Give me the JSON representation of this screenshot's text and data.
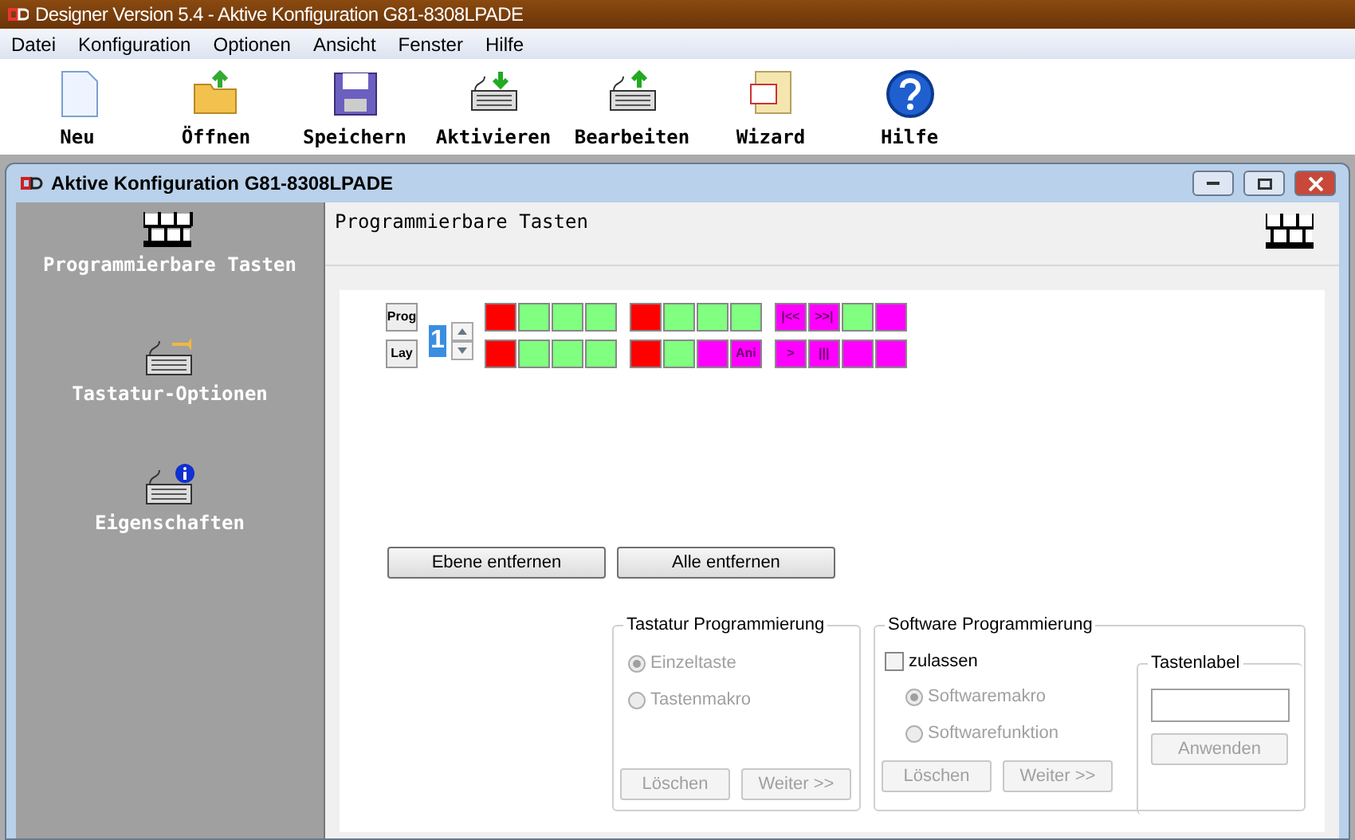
{
  "app_title": "Designer Version 5.4 - Aktive Konfiguration G81-8308LPADE",
  "menu": [
    "Datei",
    "Konfiguration",
    "Optionen",
    "Ansicht",
    "Fenster",
    "Hilfe"
  ],
  "toolbar": [
    {
      "label": "Neu",
      "kind": "new"
    },
    {
      "label": "Öffnen",
      "kind": "open"
    },
    {
      "label": "Speichern",
      "kind": "save"
    },
    {
      "label": "Aktivieren",
      "kind": "activate"
    },
    {
      "label": "Bearbeiten",
      "kind": "edit"
    },
    {
      "label": "Wizard",
      "kind": "wizard"
    },
    {
      "label": "Hilfe",
      "kind": "help"
    }
  ],
  "window": {
    "title": "Aktive Konfiguration G81-8308LPADE"
  },
  "sidebar": {
    "items": [
      {
        "label": "Programmierbare Tasten",
        "kind": "keys"
      },
      {
        "label": "Tastatur-Optionen",
        "kind": "options"
      },
      {
        "label": "Eigenschaften",
        "kind": "info"
      }
    ]
  },
  "panel_title": "Programmierbare Tasten",
  "side_buttons": [
    "Prog",
    "Lay"
  ],
  "layer": "1",
  "rows": [
    [
      [
        {
          "color": "#ff0000"
        },
        {
          "color": "#80ff80"
        },
        {
          "color": "#80ff80"
        },
        {
          "color": "#80ff80"
        }
      ],
      [
        {
          "color": "#ff0000"
        },
        {
          "color": "#80ff80"
        },
        {
          "color": "#80ff80"
        },
        {
          "color": "#80ff80"
        }
      ],
      [
        {
          "color": "#ff00ff",
          "label": "|<<"
        },
        {
          "color": "#ff00ff",
          "label": ">>|"
        },
        {
          "color": "#80ff80"
        },
        {
          "color": "#ff00ff"
        }
      ]
    ],
    [
      [
        {
          "color": "#ff0000"
        },
        {
          "color": "#80ff80"
        },
        {
          "color": "#80ff80"
        },
        {
          "color": "#80ff80"
        }
      ],
      [
        {
          "color": "#ff0000"
        },
        {
          "color": "#80ff80"
        },
        {
          "color": "#ff00ff"
        },
        {
          "color": "#ff00ff",
          "label": "Ani"
        }
      ],
      [
        {
          "color": "#ff00ff",
          "label": ">"
        },
        {
          "color": "#ff00ff",
          "label": "|||"
        },
        {
          "color": "#ff00ff"
        },
        {
          "color": "#ff00ff"
        }
      ]
    ]
  ],
  "actions": [
    "Ebene entfernen",
    "Alle entfernen"
  ],
  "keyboard_group": {
    "title": "Tastatur Programmierung",
    "options": [
      {
        "label": "Einzeltaste",
        "selected": true,
        "disabled": true
      },
      {
        "label": "Tastenmakro",
        "selected": false,
        "disabled": true
      }
    ],
    "buttons": [
      {
        "label": "Löschen",
        "disabled": true
      },
      {
        "label": "Weiter >>",
        "disabled": true
      }
    ]
  },
  "software_group": {
    "title": "Software Programmierung",
    "allow": {
      "label": "zulassen",
      "checked": false
    },
    "options": [
      {
        "label": "Softwaremakro",
        "selected": true,
        "disabled": true
      },
      {
        "label": "Softwarefunktion",
        "selected": false,
        "disabled": true
      }
    ],
    "buttons": [
      {
        "label": "Löschen",
        "disabled": true
      },
      {
        "label": "Weiter >>",
        "disabled": true
      }
    ]
  },
  "label_group": {
    "title": "Tastenlabel",
    "button": {
      "label": "Anwenden",
      "disabled": true
    }
  }
}
